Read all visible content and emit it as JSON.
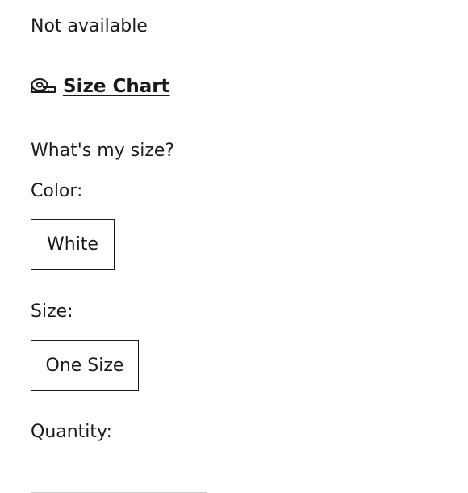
{
  "product": {
    "availability": "Not available",
    "size_chart_icon": "measuring-tape-icon",
    "size_chart_label": "Size Chart",
    "whats_my_size": "What's my size?",
    "color": {
      "label": "Color:",
      "selected": "White"
    },
    "size": {
      "label": "Size:",
      "selected": "One Size"
    },
    "quantity": {
      "label": "Quantity:"
    }
  }
}
